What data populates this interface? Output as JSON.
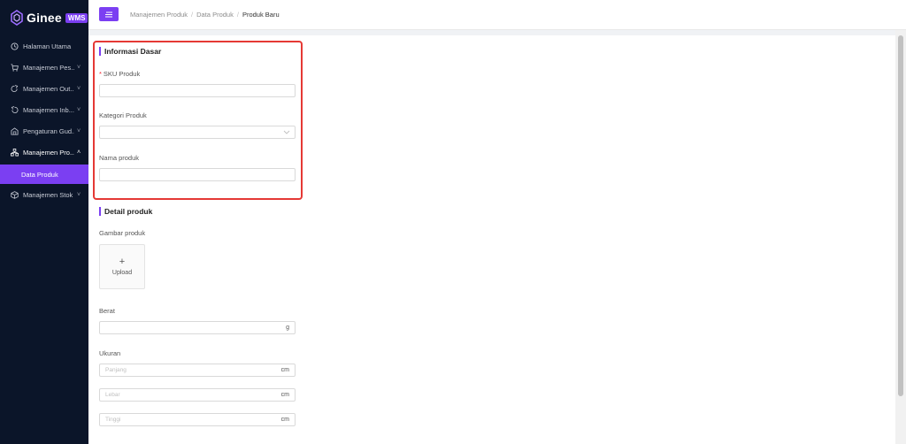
{
  "brand": {
    "name": "Ginee",
    "badge": "WMS"
  },
  "sidebar": {
    "items": [
      {
        "label": "Halaman Utama",
        "icon": "home-icon",
        "chevron": ""
      },
      {
        "label": "Manajemen Pes...",
        "icon": "cart-icon",
        "chevron": "˅"
      },
      {
        "label": "Manajemen Out...",
        "icon": "outbound-icon",
        "chevron": "˅"
      },
      {
        "label": "Manajemen Inb...",
        "icon": "inbound-icon",
        "chevron": "˅"
      },
      {
        "label": "Pengaturan Gud...",
        "icon": "warehouse-icon",
        "chevron": "˅"
      },
      {
        "label": "Manajemen Pro...",
        "icon": "product-icon",
        "chevron": "˄"
      },
      {
        "label": "Manajemen Stok",
        "icon": "stock-icon",
        "chevron": "˅"
      }
    ],
    "sub_active": "Data Produk"
  },
  "breadcrumb": {
    "level1": "Manajemen Produk",
    "level2": "Data Produk",
    "current": "Produk Baru",
    "sep": "/"
  },
  "form": {
    "section1_title": "Informasi Dasar",
    "sku_label": "SKU Produk",
    "sku_required_mark": "*",
    "kategori_label": "Kategori Produk",
    "nama_label": "Nama produk",
    "section2_title": "Detail produk",
    "gambar_label": "Gambar produk",
    "upload_plus": "+",
    "upload_label": "Upload",
    "berat_label": "Berat",
    "berat_unit": "g",
    "ukuran_label": "Ukuran",
    "panjang_placeholder": "Panjang",
    "lebar_placeholder": "Lebar",
    "tinggi_placeholder": "Tinggi",
    "dimension_unit": "cm"
  },
  "colors": {
    "accent": "#7b3ff2",
    "sidebar_bg": "#0b1529",
    "highlight": "#e53935",
    "required": "#f5222d"
  }
}
